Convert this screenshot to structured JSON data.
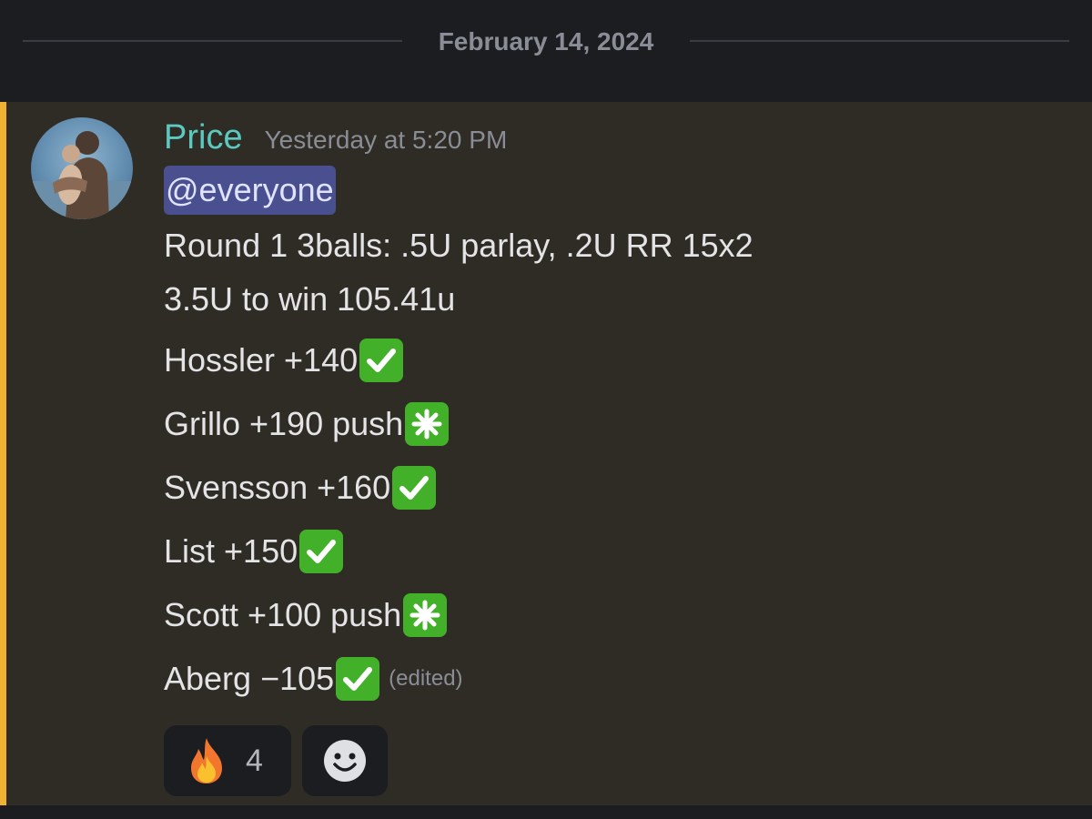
{
  "date_divider": {
    "text": "February 14, 2024"
  },
  "message": {
    "author": "Price",
    "timestamp": "Yesterday at 5:20 PM",
    "mention": "@everyone",
    "lines": [
      "Round 1 3balls: .5U parlay, .2U RR 15x2",
      "3.5U to win 105.41u"
    ],
    "picks": [
      {
        "text": "Hossler +140",
        "status_icon": "check-mark-icon"
      },
      {
        "text": "Grillo +190 push",
        "status_icon": "eight-spoked-asterisk-icon"
      },
      {
        "text": "Svensson +160",
        "status_icon": "check-mark-icon"
      },
      {
        "text": "List +150",
        "status_icon": "check-mark-icon"
      },
      {
        "text": "Scott +100 push",
        "status_icon": "eight-spoked-asterisk-icon"
      },
      {
        "text": "Aberg −105",
        "status_icon": "check-mark-icon"
      }
    ],
    "edited_label": "(edited)"
  },
  "reactions": [
    {
      "icon": "fire-icon",
      "count": "4"
    },
    {
      "icon": "add-reaction-smile-icon"
    }
  ],
  "colors": {
    "background": "#1c1d21",
    "message_highlight": "#2f2c26",
    "mention_bar": "#f0b232",
    "username": "#5cc9c1",
    "mention_bg": "#4a4f8f",
    "check_green": "#43b02a"
  }
}
